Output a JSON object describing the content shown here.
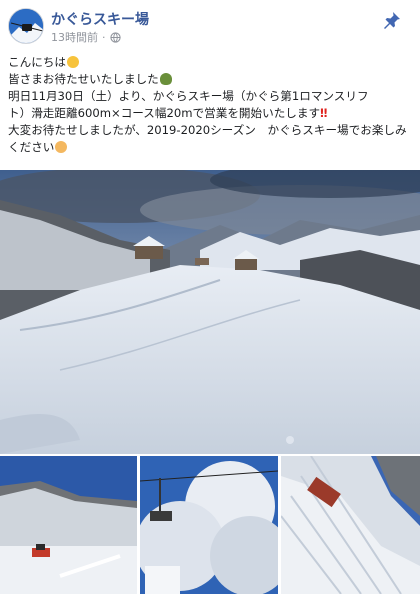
{
  "post": {
    "page_name": "かぐらスキー場",
    "timestamp": "13時間前",
    "separator": "·",
    "lines": [
      "こんにちは",
      "皆さまお待たせいたしました",
      "明日11月30日（土）より、かぐらスキー場（かぐら第1ロマンスリフ",
      "ト）滑走距離600m×コース幅20mで営業を開始いたします",
      "大変お待たせしましたが、2019-2020シーズン　かぐらスキー場でお楽しみください"
    ],
    "emoji_after_line_1": "smile",
    "emoji_after_line_2": "plant",
    "emoji_after_line_4": "‼",
    "emoji_after_line_5": "grin"
  },
  "icons": {
    "globe": "globe-icon",
    "pin": "pin-icon"
  },
  "colors": {
    "page_name": "#385898",
    "meta": "#90949c",
    "pin": "#4267b2",
    "text": "#1c1e21"
  },
  "photos": [
    {
      "subject": "snow-covered ski slope with lodges and cloudy mountain range"
    },
    {
      "subject": "snowy hill with red snow groomer"
    },
    {
      "subject": "chairlift through frosted trees"
    },
    {
      "subject": "groomed slope with snow groomer from above"
    }
  ]
}
